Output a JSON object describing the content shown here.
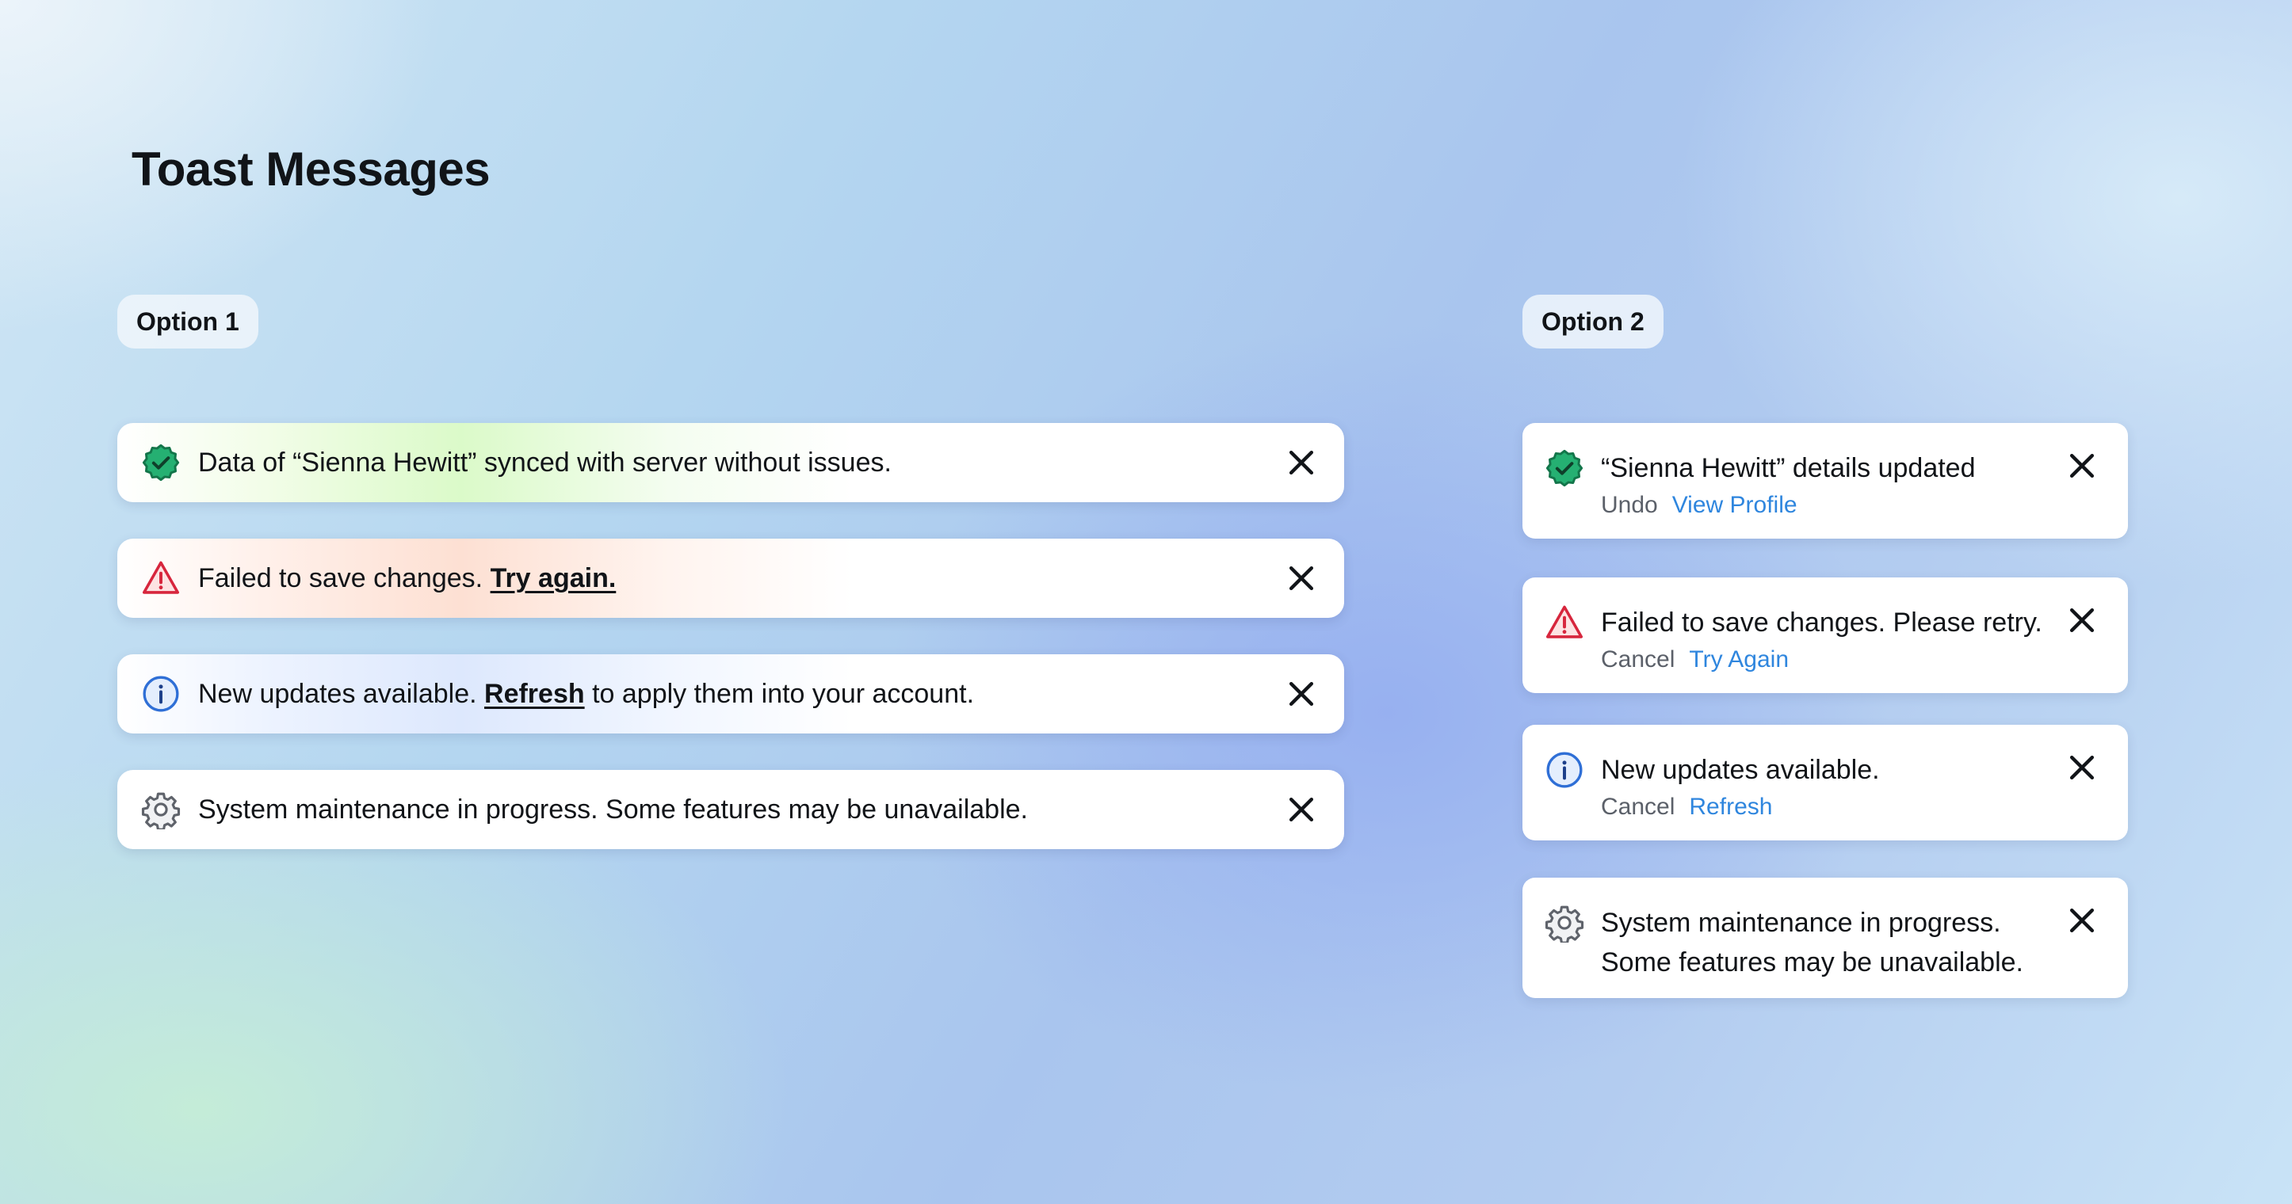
{
  "page": {
    "title": "Toast Messages"
  },
  "option1": {
    "label": "Option 1",
    "toasts": [
      {
        "type": "success",
        "icon": "verified-badge-icon",
        "text": "Data of “Sienna Hewitt” synced with server without issues."
      },
      {
        "type": "error",
        "icon": "warning-triangle-icon",
        "text": "Failed to save changes.",
        "link": "Try again."
      },
      {
        "type": "info",
        "icon": "info-circle-icon",
        "text_before": "New updates available.",
        "link": "Refresh",
        "text_after": "to apply them into your account."
      },
      {
        "type": "system",
        "icon": "gear-icon",
        "text": "System maintenance in progress. Some features may be unavailable."
      }
    ]
  },
  "option2": {
    "label": "Option 2",
    "toasts": [
      {
        "type": "success",
        "icon": "verified-badge-icon",
        "title": "“Sienna Hewitt” details updated",
        "secondary_action": "Undo",
        "primary_action": "View Profile"
      },
      {
        "type": "error",
        "icon": "warning-triangle-icon",
        "title": "Failed to save changes. Please retry.",
        "secondary_action": "Cancel",
        "primary_action": "Try Again"
      },
      {
        "type": "info",
        "icon": "info-circle-icon",
        "title": "New updates available.",
        "secondary_action": "Cancel",
        "primary_action": "Refresh"
      },
      {
        "type": "system",
        "icon": "gear-icon",
        "title_line1": "System maintenance in progress.",
        "title_line2": "Some features may be unavailable."
      }
    ]
  },
  "colors": {
    "success": "#1fa86a",
    "error": "#d7263d",
    "info": "#2f6fd6",
    "system": "#6b6f76",
    "link": "#2f86de"
  },
  "close_icon": "close-x-icon"
}
